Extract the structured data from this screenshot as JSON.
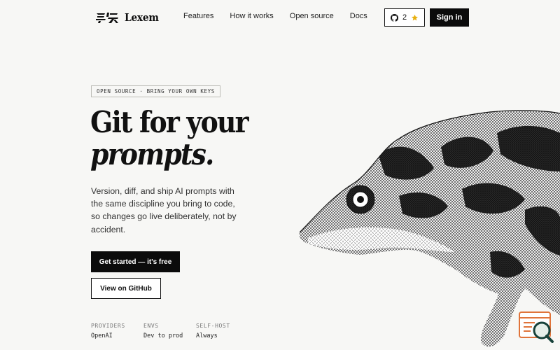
{
  "brand": {
    "name": "Lexem",
    "logo_icon": "lexem-glyph-logo"
  },
  "nav": {
    "links": [
      "Features",
      "How it works",
      "Open source",
      "Docs"
    ],
    "github": {
      "icon": "github-icon",
      "count": "2",
      "star_icon": "star-icon",
      "star_color": "#e8b00f"
    },
    "signin_label": "Sign in"
  },
  "hero": {
    "badge": "OPEN SOURCE · BRING YOUR OWN KEYS",
    "headline_line1": "Git for your",
    "headline_line2": "prompts.",
    "subtext": "Version, diff, and ship AI prompts with the same discipline you bring to code, so changes go live deliberately, not by accident.",
    "cta_primary": "Get started — it's free",
    "cta_secondary": "View on GitHub",
    "stats": [
      {
        "label": "PROVIDERS",
        "value": "OpenAI"
      },
      {
        "label": "ENVS",
        "value": "Dev to prod"
      },
      {
        "label": "SELF-HOST",
        "value": "Always"
      }
    ]
  },
  "illustration": {
    "icon": "chameleon-illustration"
  },
  "widget": {
    "icon": "search-widget-icon",
    "accent_color": "#e0743a"
  },
  "colors": {
    "background": "#f7f7f5",
    "primary": "#0b0b0b",
    "text": "#111111"
  }
}
